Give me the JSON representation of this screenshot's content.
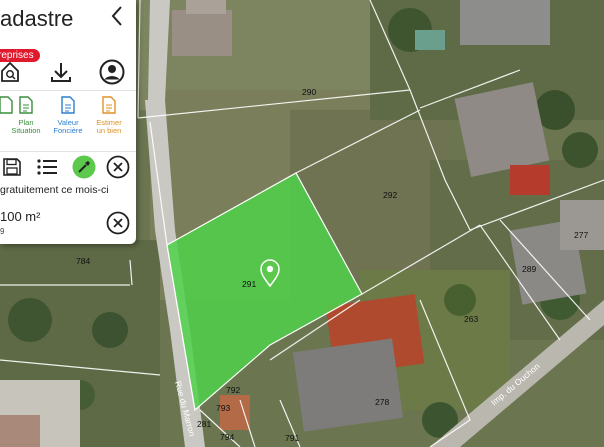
{
  "panel": {
    "title": "adastre",
    "badge": "reprises",
    "tools": [
      {
        "label": "Plan\nSituation",
        "color": "#3a8f3a"
      },
      {
        "label": "Valeur\nFoncière",
        "color": "#2b7fd1"
      },
      {
        "label": "Estimer\nun bien",
        "color": "#e0912a"
      }
    ],
    "message": "gratuitement ce mois-ci",
    "area": "100 m²",
    "area_sub": "9"
  },
  "parcels": {
    "p290": "290",
    "p292": "292",
    "p291": "291",
    "p784": "784",
    "p277": "277",
    "p289": "289",
    "p263": "263",
    "p278": "278",
    "p792": "792",
    "p793": "793",
    "p281": "281",
    "p794": "794",
    "p791": "791"
  },
  "streets": {
    "right": "Imp. du Ouchon",
    "left": "Rue du Marron"
  },
  "colors": {
    "selected": "#4fd14a",
    "accent": "#e0192d",
    "marker": "#5cc94c"
  }
}
